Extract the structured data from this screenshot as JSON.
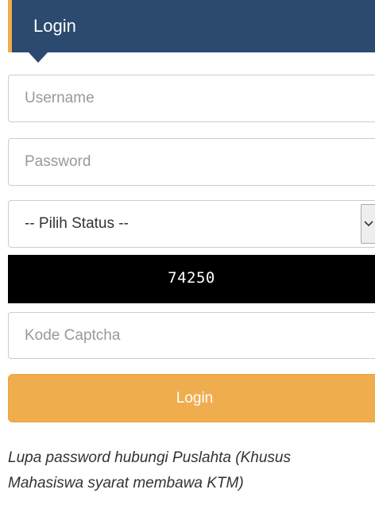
{
  "header": {
    "title": "Login"
  },
  "form": {
    "username_placeholder": "Username",
    "password_placeholder": "Password",
    "status_select_value": "-- Pilih Status --",
    "captcha_code": "74250",
    "captcha_placeholder": "Kode Captcha",
    "login_button_label": "Login"
  },
  "note": {
    "text": "Lupa password hubungi Puslahta (Khusus Mahasiswa syarat membawa KTM)"
  },
  "colors": {
    "header_bg": "#2c4a70",
    "accent": "#f0ad4e",
    "captcha_bg": "#000000"
  },
  "icons": {
    "select_arrow": "chevron-down-icon"
  }
}
